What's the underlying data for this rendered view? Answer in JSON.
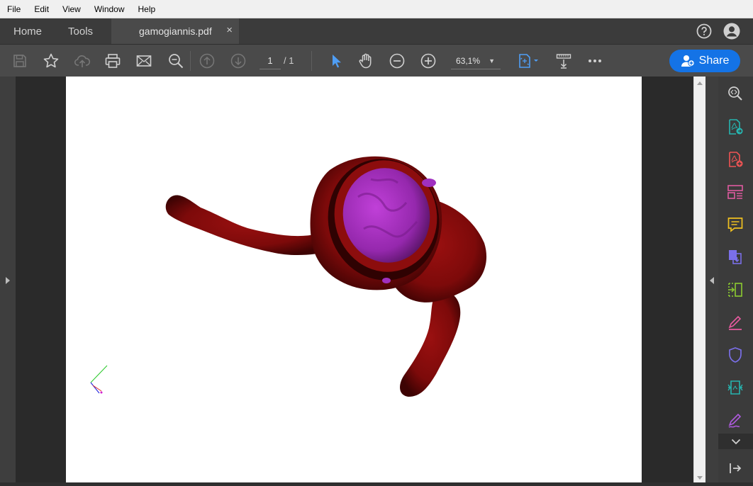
{
  "menu": {
    "items": [
      "File",
      "Edit",
      "View",
      "Window",
      "Help"
    ]
  },
  "tabs": {
    "home": "Home",
    "tools": "Tools",
    "document": "gamogiannis.pdf",
    "close_symbol": "×"
  },
  "toolbar": {
    "page_current": "1",
    "page_total": "/ 1",
    "zoom": "63,1%",
    "share_label": "Share"
  },
  "colors": {
    "accent": "#1473e6",
    "model_red": "#7d0a0a",
    "model_purple": "#b030c8"
  },
  "icons": {
    "toolbar": [
      "save-icon",
      "bookmark-star-icon",
      "upload-cloud-icon",
      "print-icon",
      "email-icon",
      "zoom-search-icon",
      "page-up-icon",
      "page-down-icon",
      "select-cursor-icon",
      "hand-icon",
      "zoom-out-icon",
      "zoom-in-icon",
      "fit-page-icon",
      "scroll-mode-icon",
      "more-icon"
    ],
    "right_rail": [
      "zoom-search-icon",
      "export-pdf-icon",
      "create-pdf-icon",
      "organize-pages-icon",
      "comment-icon",
      "combine-files-icon",
      "compress-icon",
      "fill-sign-icon",
      "protect-icon",
      "scan-ocr-icon",
      "send-signature-icon",
      "more-tools-icon",
      "collapse-panel-icon"
    ]
  }
}
